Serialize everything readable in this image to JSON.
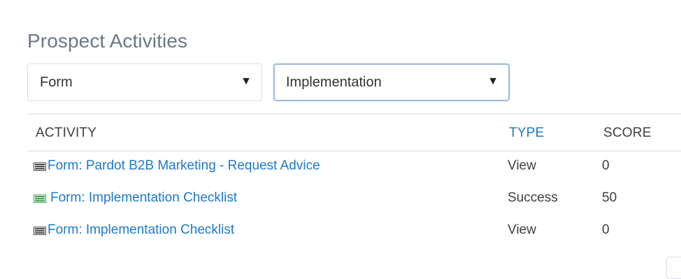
{
  "section": {
    "title": "Prospect Activities"
  },
  "filters": {
    "type_select": {
      "value": "Form",
      "arrow": "▼"
    },
    "name_select": {
      "value": "Implementation",
      "arrow": "▼"
    }
  },
  "table": {
    "headers": {
      "activity": "ACTIVITY",
      "type": "TYPE",
      "score": "SCORE"
    },
    "rows": [
      {
        "icon": "form-view-icon",
        "icon_color": "#444444",
        "activity": "Form: Pardot B2B Marketing - Request Advice",
        "type": "View",
        "score": "0"
      },
      {
        "icon": "form-success-icon",
        "icon_color": "#3a9a4f",
        "activity": "Form: Implementation Checklist",
        "type": "Success",
        "score": "50"
      },
      {
        "icon": "form-view-icon",
        "icon_color": "#444444",
        "activity": "Form: Implementation Checklist",
        "type": "View",
        "score": "0"
      }
    ]
  },
  "colors": {
    "link": "#1f78c7",
    "title": "#6b7785",
    "success_icon": "#3a9a4f"
  }
}
